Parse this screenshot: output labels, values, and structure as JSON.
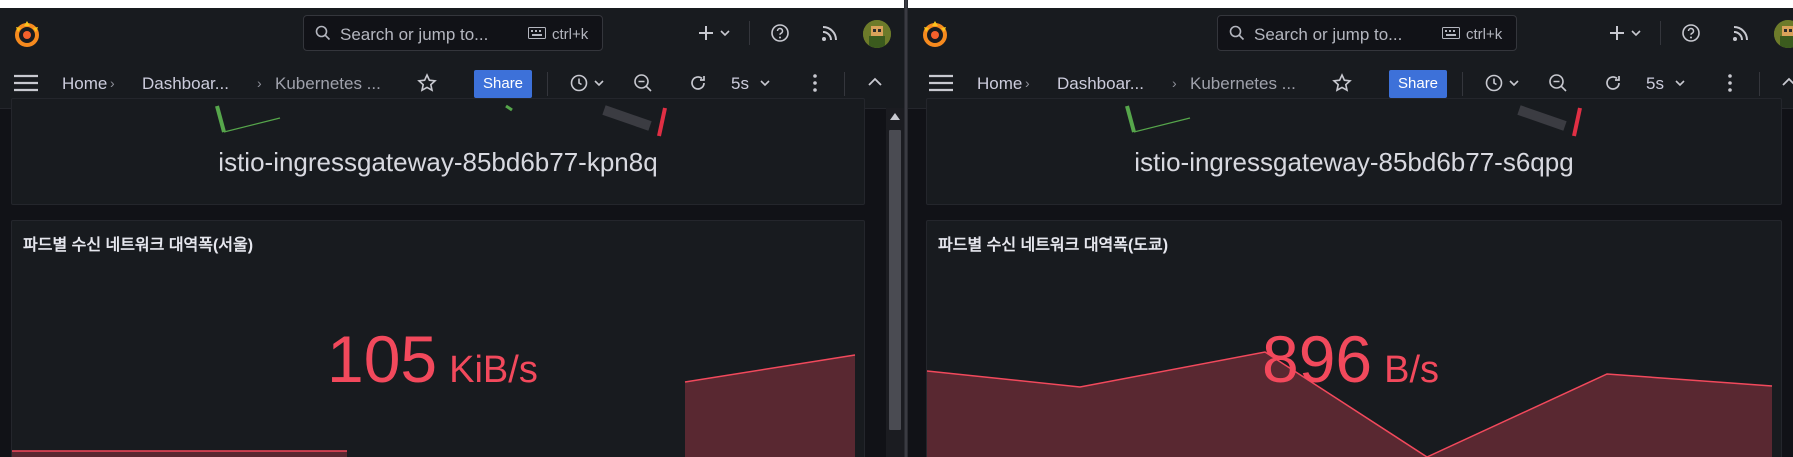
{
  "panes": {
    "left": {
      "search": {
        "placeholder": "Search or jump to...",
        "shortcut": "ctrl+k"
      },
      "breadcrumb": {
        "home": "Home",
        "dashboards": "Dashboar...",
        "current": "Kubernetes ..."
      },
      "share_label": "Share",
      "refresh_interval": "5s",
      "gauge_panel": {
        "pod_name": "istio-ingressgateway-85bd6b77-kpn8q"
      },
      "stat_panel": {
        "title": "파드별 수신 네트워크 대역폭(서울)",
        "value": "105",
        "unit": "KiB/s"
      }
    },
    "right": {
      "search": {
        "placeholder": "Search or jump to...",
        "shortcut": "ctrl+k"
      },
      "breadcrumb": {
        "home": "Home",
        "dashboards": "Dashboar...",
        "current": "Kubernetes ..."
      },
      "share_label": "Share",
      "refresh_interval": "5s",
      "gauge_panel": {
        "pod_name": "istio-ingressgateway-85bd6b77-s6qpg"
      },
      "stat_panel": {
        "title": "파드별 수신 네트워크 대역폭(도쿄)",
        "value": "896",
        "unit": "B/s"
      }
    }
  },
  "colors": {
    "stat_red": "#f2495c",
    "gauge_green": "#56a64b",
    "gauge_red": "#e02f44",
    "share_blue": "#3d71d9"
  },
  "icons": {
    "logo": "grafana-logo-icon",
    "search": "search-icon",
    "keyboard": "keyboard-icon",
    "add": "plus-icon",
    "help": "help-icon",
    "news": "rss-icon",
    "menu": "hamburger-menu-icon",
    "star": "star-icon",
    "time": "clock-icon",
    "zoom_out": "zoom-out-icon",
    "refresh": "refresh-icon",
    "more": "kebab-menu-icon",
    "collapse": "chevron-up-icon"
  }
}
